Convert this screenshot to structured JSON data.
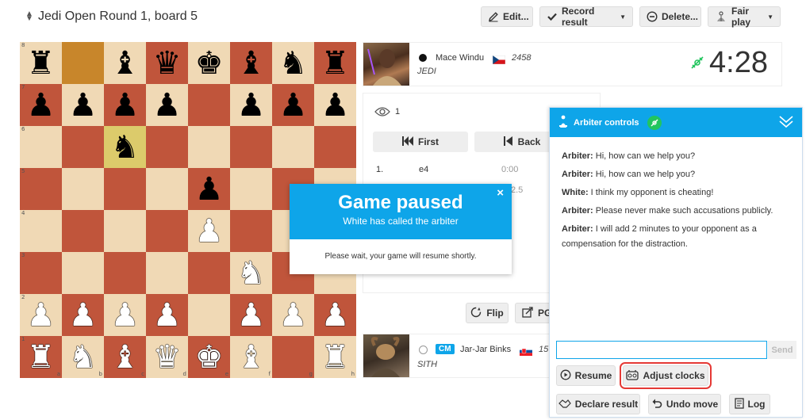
{
  "header": {
    "title": "Jedi Open Round 1, board 5",
    "edit_label": "Edit...",
    "record_label": "Record result",
    "delete_label": "Delete...",
    "fairplay_label": "Fair play"
  },
  "board": {
    "ranks": [
      "8",
      "7",
      "6",
      "5",
      "4",
      "3",
      "2",
      "1"
    ],
    "files": [
      "a",
      "b",
      "c",
      "d",
      "e",
      "f",
      "g",
      "h"
    ],
    "rows": [
      [
        "r",
        "",
        "b",
        "q",
        "k",
        "b",
        "n",
        "r"
      ],
      [
        "p",
        "p",
        "p",
        "p",
        "",
        "p",
        "p",
        "p"
      ],
      [
        "",
        "",
        "n",
        "",
        "",
        "",
        "",
        ""
      ],
      [
        "",
        "",
        "",
        "",
        "p",
        "",
        "",
        ""
      ],
      [
        "",
        "",
        "",
        "",
        "P",
        "",
        "",
        ""
      ],
      [
        "",
        "",
        "",
        "",
        "",
        "N",
        "",
        ""
      ],
      [
        "P",
        "P",
        "P",
        "P",
        "",
        "P",
        "P",
        "P"
      ],
      [
        "R",
        "N",
        "B",
        "Q",
        "K",
        "B",
        "",
        "R"
      ]
    ],
    "highlighted": [
      "b8",
      "c6"
    ]
  },
  "top_player": {
    "name": "Mace Windu",
    "rating": "2458",
    "team": "JEDI",
    "clock": "4:28",
    "color": "black",
    "flag": "CZ"
  },
  "bottom_player": {
    "title": "CM",
    "name": "Jar-Jar Binks",
    "rating": "15",
    "team": "SITH",
    "color": "white",
    "flag": "SK"
  },
  "moves_panel": {
    "spectators": "1",
    "first_label": "First",
    "back_label": "Back",
    "moves": [
      {
        "num": "1.",
        "san": "e4",
        "time": "0:00"
      },
      {
        "num": "",
        "san": "",
        "time": "2.5"
      }
    ],
    "flip_label": "Flip",
    "pgn_label": "PG"
  },
  "pause_modal": {
    "title": "Game paused",
    "subtitle": "White has called the arbiter",
    "body": "Please wait, your game will resume shortly.",
    "close": "×"
  },
  "arbiter": {
    "title": "Arbiter controls",
    "messages": [
      {
        "speaker": "Arbiter:",
        "text": "Hi, how can we help you?"
      },
      {
        "speaker": "Arbiter:",
        "text": "Hi, how can we help you?"
      },
      {
        "speaker": "White:",
        "text": "I think my opponent is cheating!"
      },
      {
        "speaker": "Arbiter:",
        "text": "Please never make such accusations publicly."
      },
      {
        "speaker": "Arbiter:",
        "text": "I will add 2 minutes to your opponent as a compensation for the distraction."
      }
    ],
    "input_value": "",
    "send_label": "Send",
    "resume_label": "Resume",
    "adjust_label": "Adjust clocks",
    "declare_label": "Declare result",
    "undo_label": "Undo move",
    "log_label": "Log"
  },
  "colors": {
    "accent": "#0ea5e9",
    "light_square": "#f0d9b5",
    "dark_square": "#c0553b",
    "highlight_outline": "#e53935",
    "online": "#22c55e"
  }
}
